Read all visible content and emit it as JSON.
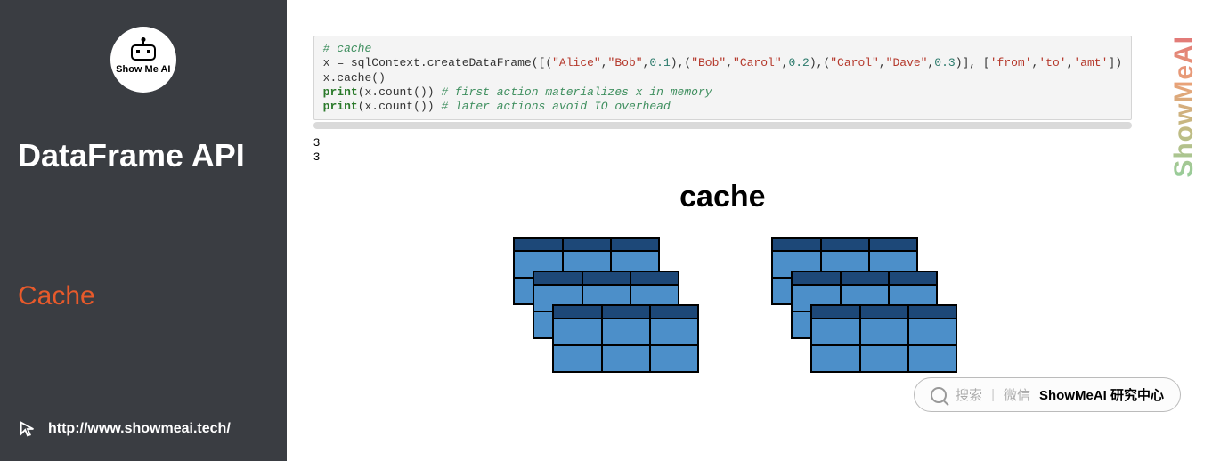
{
  "sidebar": {
    "logo_text": "Show Me AI",
    "title": "DataFrame API",
    "subtitle": "Cache",
    "footer_url": "http://www.showmeai.tech/"
  },
  "code": {
    "line1_comment": "# cache",
    "line2_prefix": "x = sqlContext.createDataFrame([(",
    "line2_s1": "\"Alice\"",
    "line2_s2": "\"Bob\"",
    "line2_n1": "0.1",
    "line2_mid1": "),(",
    "line2_s3": "\"Bob\"",
    "line2_s4": "\"Carol\"",
    "line2_n2": "0.2",
    "line2_mid2": "),(",
    "line2_s5": "\"Carol\"",
    "line2_s6": "\"Dave\"",
    "line2_n3": "0.3",
    "line2_suffix": ")], [",
    "line2_c1": "'from'",
    "line2_c2": "'to'",
    "line2_c3": "'amt'",
    "line2_end": "])",
    "line3": "x.cache()",
    "line4_kw": "print",
    "line4_call": "(x.count()) ",
    "line4_comment": "# first action materializes x in memory",
    "line5_kw": "print",
    "line5_call": "(x.count()) ",
    "line5_comment": "# later actions avoid IO overhead"
  },
  "output": {
    "line1": "3",
    "line2": "3"
  },
  "heading": "cache",
  "watermark": "ShowMeAI",
  "search": {
    "hint1": "搜索",
    "hint2": "微信",
    "brand": "ShowMeAI 研究中心"
  }
}
